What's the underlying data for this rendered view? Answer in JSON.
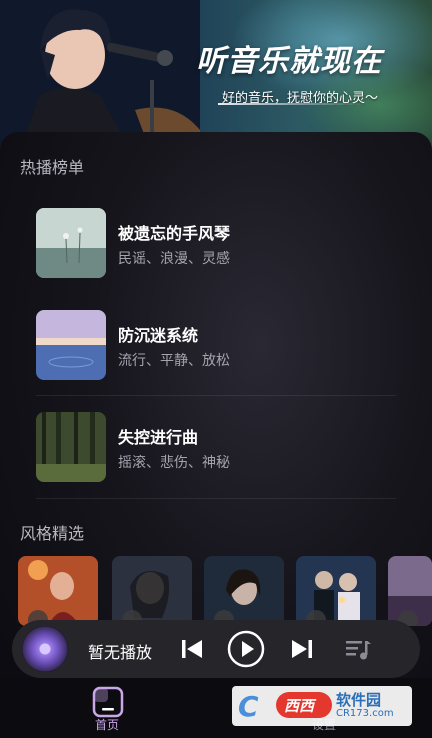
{
  "hero": {
    "title": "听音乐就现在",
    "subtitle": "好的音乐，抚慰你的心灵～"
  },
  "hot_chart": {
    "title": "热播榜单",
    "songs": [
      {
        "name": "被遗忘的手风琴",
        "tags": "民谣、浪漫、灵感",
        "cover": "misty-field-cover"
      },
      {
        "name": "防沉迷系统",
        "tags": "流行、平静、放松",
        "cover": "sunset-lake-cover"
      },
      {
        "name": "失控进行曲",
        "tags": "摇滚、悲伤、神秘",
        "cover": "forest-cover"
      }
    ]
  },
  "styles": {
    "title": "风格精选",
    "items": [
      "stage-singer-card",
      "woman-singer-card",
      "portrait-card",
      "couple-card",
      "partial-card"
    ]
  },
  "player": {
    "status": "暂无播放",
    "icons": [
      "disc-icon",
      "previous-icon",
      "play-icon",
      "next-icon",
      "playlist-icon"
    ]
  },
  "nav": {
    "home_label": "首页",
    "settings_label": "设置"
  },
  "watermark": {
    "mark": "C",
    "badge": "西西",
    "name": "软件园",
    "url": "CR173.com"
  },
  "colors": {
    "accent": "#c9a7e8",
    "background": "#0c0b10",
    "player_bg": "#262529"
  }
}
